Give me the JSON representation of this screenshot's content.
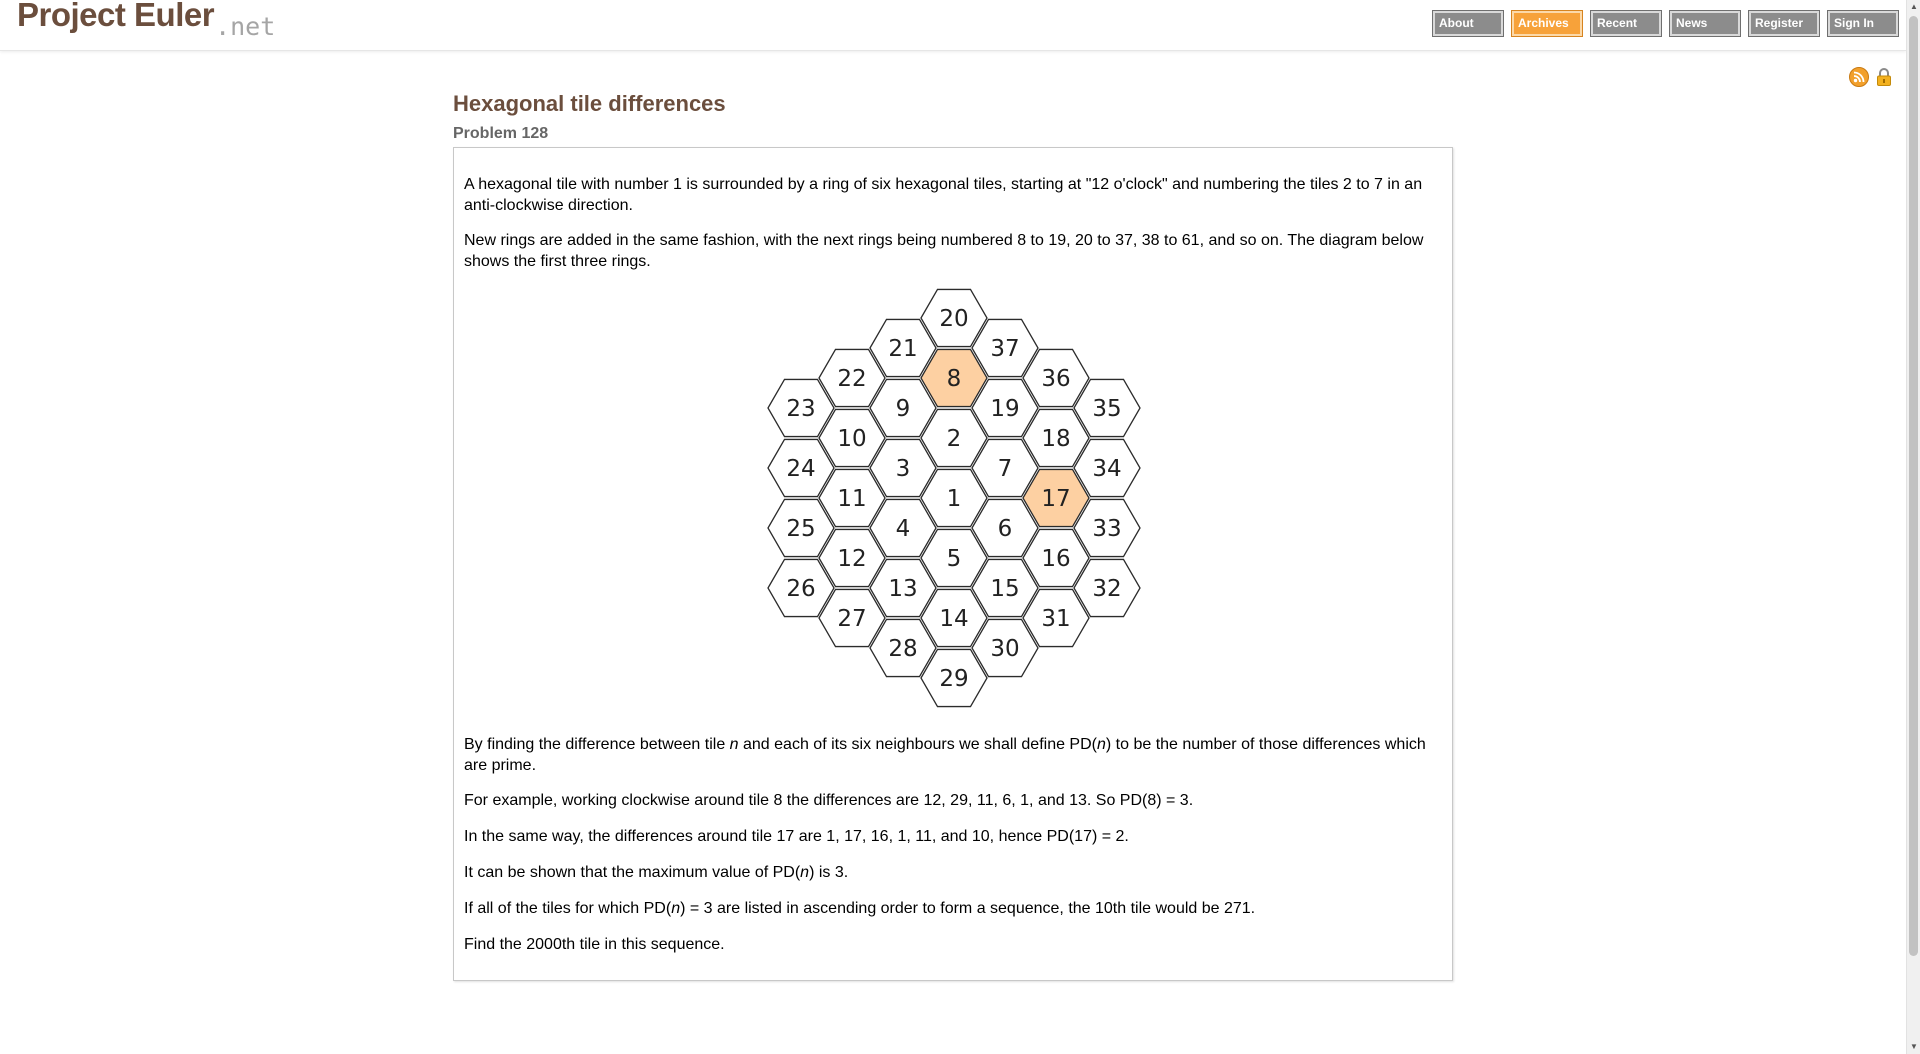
{
  "logo": {
    "main": "Project Euler",
    "suffix": ".net"
  },
  "nav": [
    {
      "label": "About",
      "active": false
    },
    {
      "label": "Archives",
      "active": true
    },
    {
      "label": "Recent",
      "active": false
    },
    {
      "label": "News",
      "active": false
    },
    {
      "label": "Register",
      "active": false
    },
    {
      "label": "Sign In",
      "active": false
    }
  ],
  "icons": [
    "rss-icon",
    "lock-icon"
  ],
  "problem": {
    "title": "Hexagonal tile differences",
    "subtitle": "Problem 128",
    "intro1": "A hexagonal tile with number 1 is surrounded by a ring of six hexagonal tiles, starting at \"12 o'clock\" and numbering the tiles 2 to 7 in an anti-clockwise direction.",
    "intro2": "New rings are added in the same fashion, with the next rings being numbered 8 to 19, 20 to 37, 38 to 61, and so on. The diagram below shows the first three rings.",
    "p3_pre": "By finding the difference between tile ",
    "p3_n": "n",
    "p3_mid": " and each of its six neighbours we shall define PD(",
    "p3_n2": "n",
    "p3_post": ") to be the number of those differences which are prime.",
    "p4": "For example, working clockwise around tile 8 the differences are 12, 29, 11, 6, 1, and 13. So PD(8) = 3.",
    "p5": "In the same way, the differences around tile 17 are 1, 17, 16, 1, 11, and 10, hence PD(17) = 2.",
    "p6_pre": "It can be shown that the maximum value of PD(",
    "p6_n": "n",
    "p6_post": ") is 3.",
    "p7_pre": "If all of the tiles for which PD(",
    "p7_n": "n",
    "p7_post": ") = 3 are listed in ascending order to form a sequence, the 10th tile would be 271.",
    "p8": "Find the 2000th tile in this sequence."
  },
  "diagram": {
    "highlight_color": "#fdd0a2",
    "tiles": [
      {
        "label": "20",
        "col": 0,
        "row": -6,
        "highlight": false
      },
      {
        "label": "21",
        "col": -1,
        "row": -5,
        "highlight": false
      },
      {
        "label": "37",
        "col": 1,
        "row": -5,
        "highlight": false
      },
      {
        "label": "22",
        "col": -2,
        "row": -4,
        "highlight": false
      },
      {
        "label": "8",
        "col": 0,
        "row": -4,
        "highlight": true
      },
      {
        "label": "36",
        "col": 2,
        "row": -4,
        "highlight": false
      },
      {
        "label": "23",
        "col": -3,
        "row": -3,
        "highlight": false
      },
      {
        "label": "9",
        "col": -1,
        "row": -3,
        "highlight": false
      },
      {
        "label": "19",
        "col": 1,
        "row": -3,
        "highlight": false
      },
      {
        "label": "35",
        "col": 3,
        "row": -3,
        "highlight": false
      },
      {
        "label": "10",
        "col": -2,
        "row": -2,
        "highlight": false
      },
      {
        "label": "2",
        "col": 0,
        "row": -2,
        "highlight": false
      },
      {
        "label": "18",
        "col": 2,
        "row": -2,
        "highlight": false
      },
      {
        "label": "24",
        "col": -3,
        "row": -1,
        "highlight": false
      },
      {
        "label": "3",
        "col": -1,
        "row": -1,
        "highlight": false
      },
      {
        "label": "7",
        "col": 1,
        "row": -1,
        "highlight": false
      },
      {
        "label": "34",
        "col": 3,
        "row": -1,
        "highlight": false
      },
      {
        "label": "11",
        "col": -2,
        "row": 0,
        "highlight": false
      },
      {
        "label": "1",
        "col": 0,
        "row": 0,
        "highlight": false
      },
      {
        "label": "17",
        "col": 2,
        "row": 0,
        "highlight": true
      },
      {
        "label": "25",
        "col": -3,
        "row": 1,
        "highlight": false
      },
      {
        "label": "4",
        "col": -1,
        "row": 1,
        "highlight": false
      },
      {
        "label": "6",
        "col": 1,
        "row": 1,
        "highlight": false
      },
      {
        "label": "33",
        "col": 3,
        "row": 1,
        "highlight": false
      },
      {
        "label": "12",
        "col": -2,
        "row": 2,
        "highlight": false
      },
      {
        "label": "5",
        "col": 0,
        "row": 2,
        "highlight": false
      },
      {
        "label": "16",
        "col": 2,
        "row": 2,
        "highlight": false
      },
      {
        "label": "26",
        "col": -3,
        "row": 3,
        "highlight": false
      },
      {
        "label": "13",
        "col": -1,
        "row": 3,
        "highlight": false
      },
      {
        "label": "15",
        "col": 1,
        "row": 3,
        "highlight": false
      },
      {
        "label": "32",
        "col": 3,
        "row": 3,
        "highlight": false
      },
      {
        "label": "27",
        "col": -2,
        "row": 4,
        "highlight": false
      },
      {
        "label": "14",
        "col": 0,
        "row": 4,
        "highlight": false
      },
      {
        "label": "31",
        "col": 2,
        "row": 4,
        "highlight": false
      },
      {
        "label": "28",
        "col": -1,
        "row": 5,
        "highlight": false
      },
      {
        "label": "30",
        "col": 1,
        "row": 5,
        "highlight": false
      },
      {
        "label": "29",
        "col": 0,
        "row": 6,
        "highlight": false
      }
    ]
  }
}
